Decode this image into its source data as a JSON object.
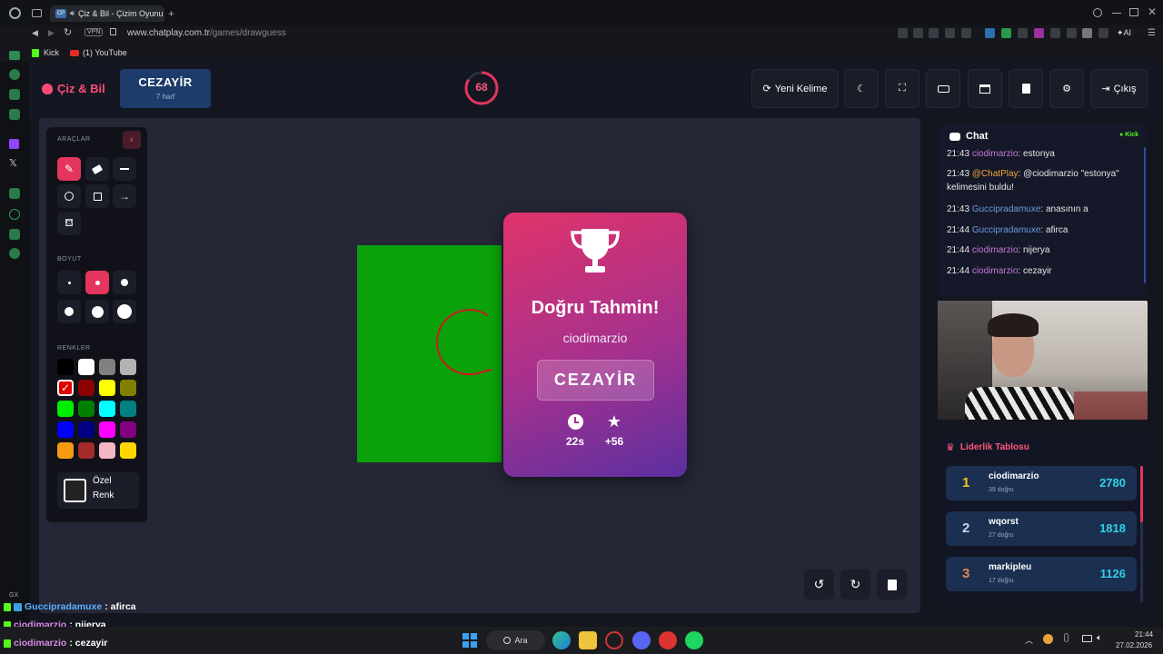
{
  "browser": {
    "tab_title": "Çiz & Bil - Çizim Oyunu",
    "tab_favicon": "CP",
    "vpn_label": "VPN",
    "url_host": "www.chatplay.com.tr",
    "url_path": "/games/drawguess",
    "ai_label": "AI",
    "bookmarks": [
      {
        "label": "Kick",
        "icon": "kick-icon"
      },
      {
        "label": "(1) YouTube",
        "icon": "youtube-icon"
      }
    ]
  },
  "game": {
    "logo": "Çiz & Bil",
    "word": "CEZAYİR",
    "word_hint": "7 harf",
    "timer": "68",
    "buttons": {
      "new_word": "Yeni Kelime",
      "exit": "Çıkış"
    }
  },
  "tools": {
    "section_tools": "ARAÇLAR",
    "section_size": "BOYUT",
    "section_colors": "RENKLER",
    "custom_color_line1": "Özel",
    "custom_color_line2": "Renk",
    "colors": [
      "#000000",
      "#ffffff",
      "#808080",
      "#b3b3b3",
      "#e00000",
      "#8b0000",
      "#ffff00",
      "#808000",
      "#00ee00",
      "#008000",
      "#00ffff",
      "#008080",
      "#0000ff",
      "#000080",
      "#ff00ff",
      "#800080",
      "#f39c12",
      "#a52a2a",
      "#f4b6c2",
      "#ffd700"
    ]
  },
  "result": {
    "title": "Doğru Tahmin!",
    "user": "ciodimarzio",
    "answer": "CEZAYİR",
    "time": "22s",
    "points": "+56"
  },
  "chat": {
    "title": "Chat",
    "platform": "Kick",
    "messages": [
      {
        "time": "21:43",
        "user": "ciodimarzio",
        "text": ": estonya"
      },
      {
        "time": "21:43",
        "user": "@ChatPlay",
        "text": ": @ciodimarzio \"estonya\" kelimesini buldu!"
      },
      {
        "time": "21:43",
        "user": "Guccipradamuxe",
        "text": ": anasının a"
      },
      {
        "time": "21:44",
        "user": "Guccipradamuxe",
        "text": ": afirca"
      },
      {
        "time": "21:44",
        "user": "ciodimarzio",
        "text": ": nijerya"
      },
      {
        "time": "21:44",
        "user": "ciodimarzio",
        "text": ": cezayir"
      }
    ]
  },
  "leaderboard": {
    "title": "Liderlik Tablosu",
    "rows": [
      {
        "rank": "1",
        "name": "ciodimarzio",
        "sub": "39 doğru",
        "points": "2780"
      },
      {
        "rank": "2",
        "name": "wqorst",
        "sub": "27 doğru",
        "points": "1818"
      },
      {
        "rank": "3",
        "name": "markipleu",
        "sub": "17 doğru",
        "points": "1126"
      }
    ]
  },
  "overlay_chat": {
    "gx_label": "GX",
    "lines": [
      {
        "user": "Guccipradamuxe",
        "text": " : afirca"
      },
      {
        "user": "ciodimarzio",
        "text": " : nijerya"
      },
      {
        "user": "ciodimarzio",
        "text": " : cezayir"
      }
    ]
  },
  "taskbar": {
    "search_label": "Ara",
    "time": "21:44",
    "date": "27.02.2026"
  }
}
